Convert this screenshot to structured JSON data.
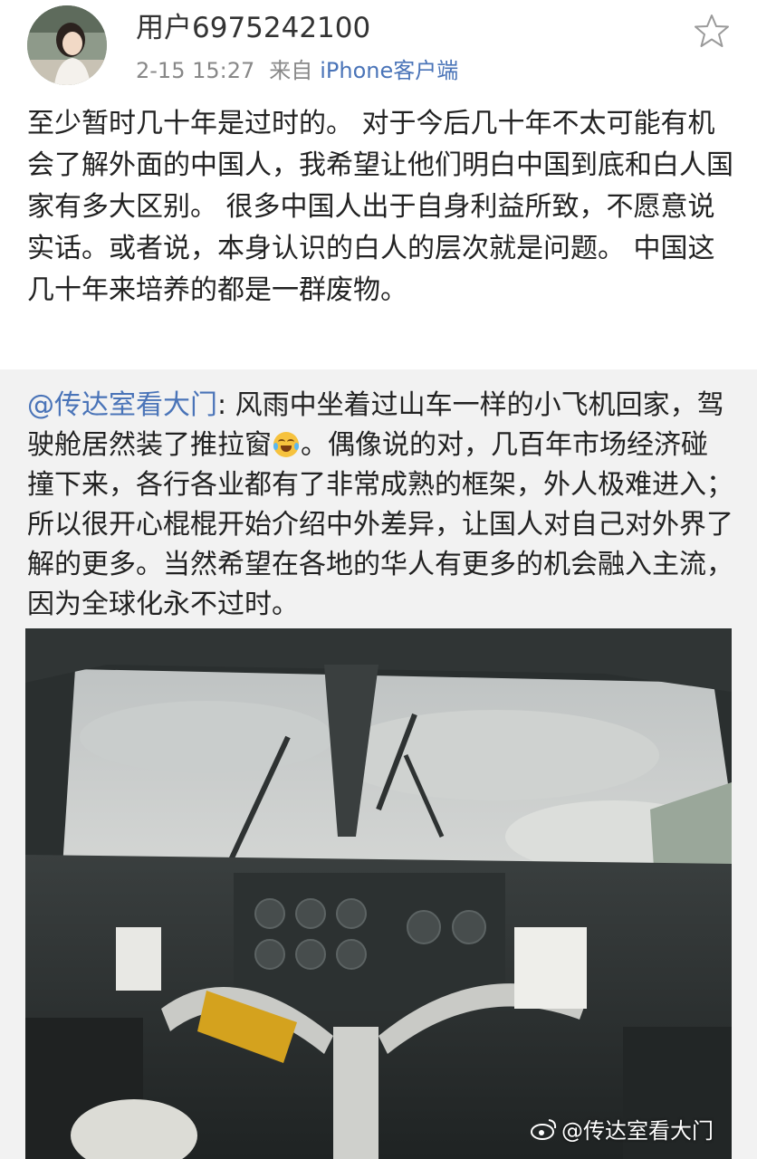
{
  "user": {
    "name": "用户6975242100",
    "time": "2-15 15:27",
    "source_prefix": "来自",
    "source_client": "iPhone客户端"
  },
  "post": {
    "text": "至少暂时几十年是过时的。 对于今后几十年不太可能有机会了解外面的中国人，我希望让他们明白中国到底和白人国家有多大区别。 很多中国人出于自身利益所致，不愿意说实话。或者说，本身认识的白人的层次就是问题。 中国这几十年来培养的都是一群废物。"
  },
  "retweet": {
    "user": "@传达室看大门",
    "text_before_emoji": ": 风雨中坐着过山车一样的小飞机回家，驾驶舱居然装了推拉窗",
    "emoji": "laugh-cry-emoji",
    "text_after_emoji": "。偶像说的对，几百年市场经济碰撞下来，各行各业都有了非常成熟的框架，外人极难进入；所以很开心棍棍开始介绍中外差异，让国人对自己对外界了解的更多。当然希望在各地的华人有更多的机会融入主流，因为全球化永不过时。",
    "image_watermark": "@传达室看大门"
  },
  "colors": {
    "link": "#4a74b8",
    "meta": "#888888",
    "retweet_bg": "#f2f2f2"
  }
}
